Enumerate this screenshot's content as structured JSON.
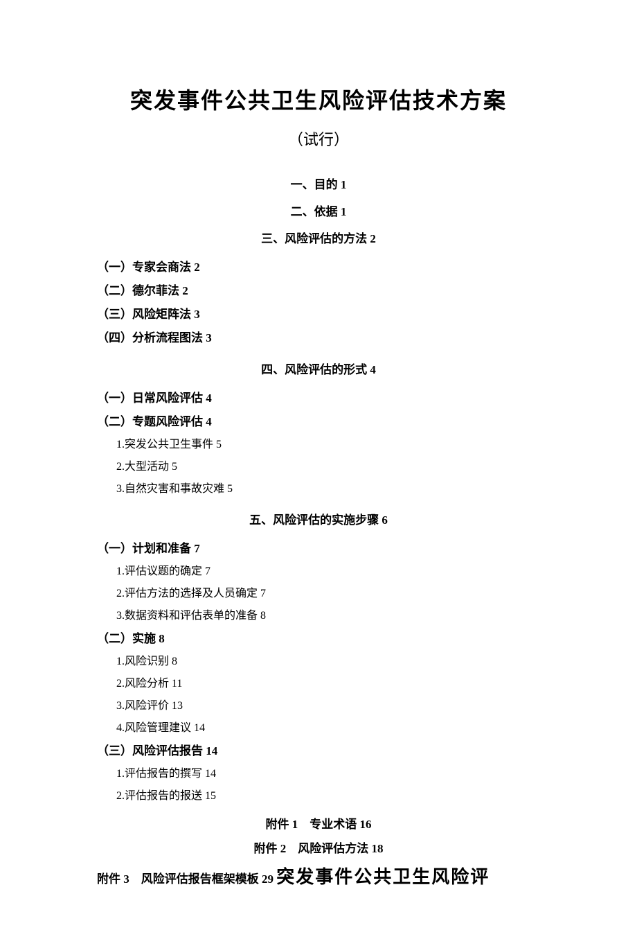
{
  "title": "突发事件公共卫生风险评估技术方案",
  "subtitle": "（试行）",
  "toc": {
    "s1": "一、目的 1",
    "s2": "二、依据 1",
    "s3": "三、风险评估的方法 2",
    "s3_1": "（一）专家会商法 2",
    "s3_2": "（二）德尔菲法 2",
    "s3_3": "（三）风险矩阵法 3",
    "s3_4": "（四）分析流程图法 3",
    "s4": "四、风险评估的形式 4",
    "s4_1": "（一）日常风险评估 4",
    "s4_2": "（二）专题风险评估 4",
    "s4_2_1": "1.突发公共卫生事件 5",
    "s4_2_2": "2.大型活动 5",
    "s4_2_3": "3.自然灾害和事故灾难 5",
    "s5": "五、风险评估的实施步骤 6",
    "s5_1": "（一）计划和准备 7",
    "s5_1_1": "1.评估议题的确定 7",
    "s5_1_2": "2.评估方法的选择及人员确定 7",
    "s5_1_3": "3.数据资料和评估表单的准备 8",
    "s5_2": "（二）实施 8",
    "s5_2_1": "1.风险识别 8",
    "s5_2_2": "2.风险分析 11",
    "s5_2_3": "3.风险评价 13",
    "s5_2_4": "4.风险管理建议 14",
    "s5_3": "（三）风险评估报告 14",
    "s5_3_1": "1.评估报告的撰写 14",
    "s5_3_2": "2.评估报告的报送 15",
    "app1": "附件 1　专业术语 16",
    "app2": "附件 2　风险评估方法 18",
    "app3_prefix": "附件 3　风险评估报告框架模板 29 ",
    "app3_title": "突发事件公共卫生风险评"
  }
}
